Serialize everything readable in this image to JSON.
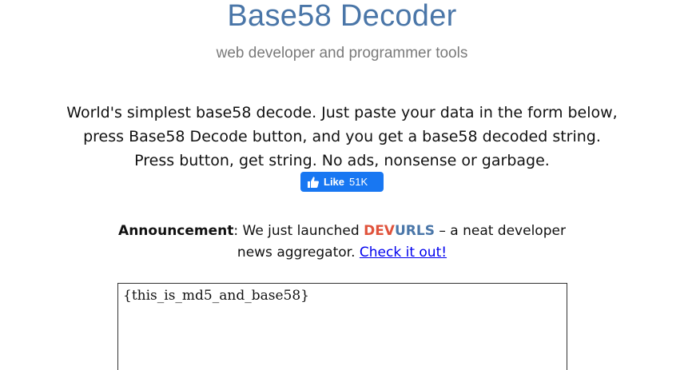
{
  "header": {
    "title": "Base58 Decoder",
    "subtitle": "web developer and programmer tools"
  },
  "intro": {
    "text": "World's simplest base58 decode. Just paste your data in the form below, press Base58 Decode button, and you get a base58 decoded string. Press button, get string. No ads, nonsense or garbage."
  },
  "like": {
    "label": "Like",
    "count": "51K",
    "color": "#1877f2"
  },
  "announcement": {
    "label": "Announcement",
    "text_before": ": We just launched ",
    "brand_part1": "DEV",
    "brand_part2": "URLS",
    "text_after": " – a neat developer news aggregator. ",
    "link_text": "Check it out!"
  },
  "input": {
    "value": "{this_is_md5_and_base58}"
  },
  "colors": {
    "title": "#4a76a8",
    "brand_dev": "#e0533c",
    "brand_urls": "#4a76a8",
    "link": "#0000ee"
  }
}
